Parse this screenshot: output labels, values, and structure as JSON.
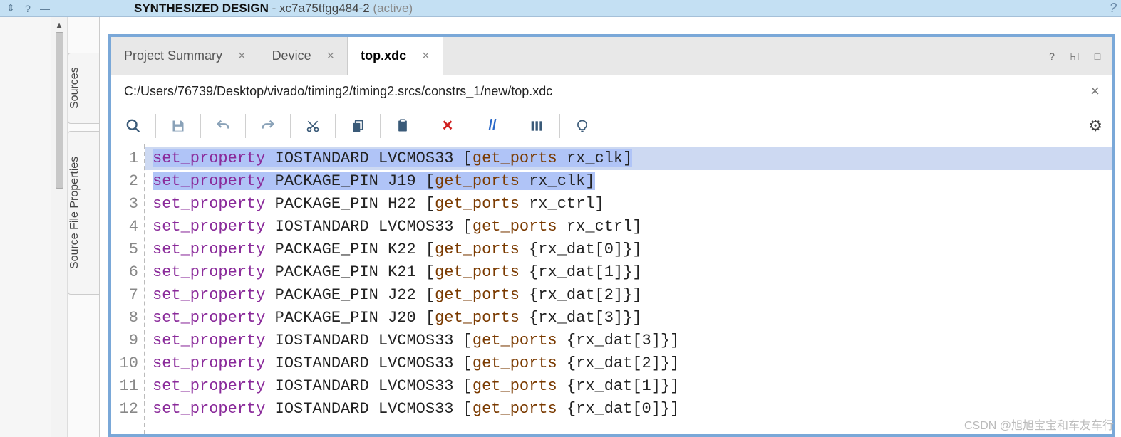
{
  "titlebar": {
    "label_bold": "SYNTHESIZED DESIGN",
    "label_part": " - xc7a75tfgg484-2",
    "label_status": "  (active)"
  },
  "sidepanels": {
    "sources": "Sources",
    "props": "Source File Properties"
  },
  "tabs": [
    {
      "label": "Project Summary",
      "active": false
    },
    {
      "label": "Device",
      "active": false
    },
    {
      "label": "top.xdc",
      "active": true
    }
  ],
  "filepath": "C:/Users/76739/Desktop/vivado/timing2/timing2.srcs/constrs_1/new/top.xdc",
  "code_lines": [
    {
      "n": "1",
      "sel": true,
      "cmd": "set_property",
      "arg": "IOSTANDARD LVCMOS33",
      "fn": "get_ports",
      "tgt": "rx_clk",
      "brace": false
    },
    {
      "n": "2",
      "sel": true,
      "cmd": "set_property",
      "arg": "PACKAGE_PIN J19",
      "fn": "get_ports",
      "tgt": "rx_clk",
      "brace": false
    },
    {
      "n": "3",
      "sel": false,
      "cmd": "set_property",
      "arg": "PACKAGE_PIN H22",
      "fn": "get_ports",
      "tgt": "rx_ctrl",
      "brace": false
    },
    {
      "n": "4",
      "sel": false,
      "cmd": "set_property",
      "arg": "IOSTANDARD LVCMOS33",
      "fn": "get_ports",
      "tgt": "rx_ctrl",
      "brace": false
    },
    {
      "n": "5",
      "sel": false,
      "cmd": "set_property",
      "arg": "PACKAGE_PIN K22",
      "fn": "get_ports",
      "tgt": "rx_dat[0]",
      "brace": true
    },
    {
      "n": "6",
      "sel": false,
      "cmd": "set_property",
      "arg": "PACKAGE_PIN K21",
      "fn": "get_ports",
      "tgt": "rx_dat[1]",
      "brace": true
    },
    {
      "n": "7",
      "sel": false,
      "cmd": "set_property",
      "arg": "PACKAGE_PIN J22",
      "fn": "get_ports",
      "tgt": "rx_dat[2]",
      "brace": true
    },
    {
      "n": "8",
      "sel": false,
      "cmd": "set_property",
      "arg": "PACKAGE_PIN J20",
      "fn": "get_ports",
      "tgt": "rx_dat[3]",
      "brace": true
    },
    {
      "n": "9",
      "sel": false,
      "cmd": "set_property",
      "arg": "IOSTANDARD LVCMOS33",
      "fn": "get_ports",
      "tgt": "rx_dat[3]",
      "brace": true
    },
    {
      "n": "10",
      "sel": false,
      "cmd": "set_property",
      "arg": "IOSTANDARD LVCMOS33",
      "fn": "get_ports",
      "tgt": "rx_dat[2]",
      "brace": true
    },
    {
      "n": "11",
      "sel": false,
      "cmd": "set_property",
      "arg": "IOSTANDARD LVCMOS33",
      "fn": "get_ports",
      "tgt": "rx_dat[1]",
      "brace": true
    },
    {
      "n": "12",
      "sel": false,
      "cmd": "set_property",
      "arg": "IOSTANDARD LVCMOS33",
      "fn": "get_ports",
      "tgt": "rx_dat[0]",
      "brace": true
    }
  ],
  "watermark": "CSDN @旭旭宝宝和车友车行"
}
